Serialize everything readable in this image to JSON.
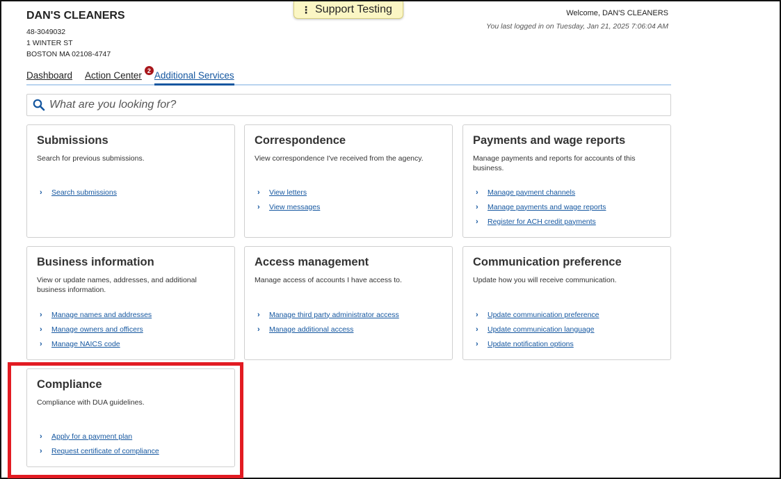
{
  "support_tab": {
    "label": "Support Testing"
  },
  "business": {
    "name": "DAN'S CLEANERS",
    "id": "48-3049032",
    "address1": "1 WINTER ST",
    "address2": "BOSTON MA 02108-4747"
  },
  "header": {
    "welcome": "Welcome, DAN'S CLEANERS",
    "last_login": "You last logged in on Tuesday, Jan 21, 2025 7:06:04 AM"
  },
  "tabs": [
    {
      "label": "Dashboard"
    },
    {
      "label": "Action Center",
      "badge": "2"
    },
    {
      "label": "Additional Services",
      "active": true
    }
  ],
  "search": {
    "placeholder": "What are you looking for?"
  },
  "cards": [
    {
      "title": "Submissions",
      "description": "Search for previous submissions.",
      "links": [
        "Search submissions"
      ]
    },
    {
      "title": "Correspondence",
      "description": "View correspondence I've received from the agency.",
      "links": [
        "View letters",
        "View messages"
      ]
    },
    {
      "title": "Payments and wage reports",
      "description": "Manage payments and reports for accounts of this business.",
      "links": [
        "Manage payment channels",
        "Manage payments and wage reports",
        "Register for ACH credit payments"
      ]
    },
    {
      "title": "Business information",
      "description": "View or update names, addresses, and additional business information.",
      "links": [
        "Manage names and addresses",
        "Manage owners and officers",
        "Manage NAICS code"
      ]
    },
    {
      "title": "Access management",
      "description": "Manage access of accounts I have access to.",
      "links": [
        "Manage third party administrator access",
        "Manage additional access"
      ]
    },
    {
      "title": "Communication preference",
      "description": "Update how you will receive communication.",
      "links": [
        "Update communication preference",
        "Update communication language",
        "Update notification options"
      ]
    },
    {
      "title": "Compliance",
      "description": "Compliance with DUA guidelines.",
      "links": [
        "Apply for a payment plan",
        "Request certificate of compliance"
      ]
    }
  ],
  "colors": {
    "link": "#1557a0",
    "highlight": "#e21b22",
    "badge": "#a8161b",
    "support_tab": "#fbf6c4"
  },
  "icons": {
    "search": "search-icon",
    "chevron": "chevron-right-icon",
    "menu": "vertical-dots-icon"
  }
}
